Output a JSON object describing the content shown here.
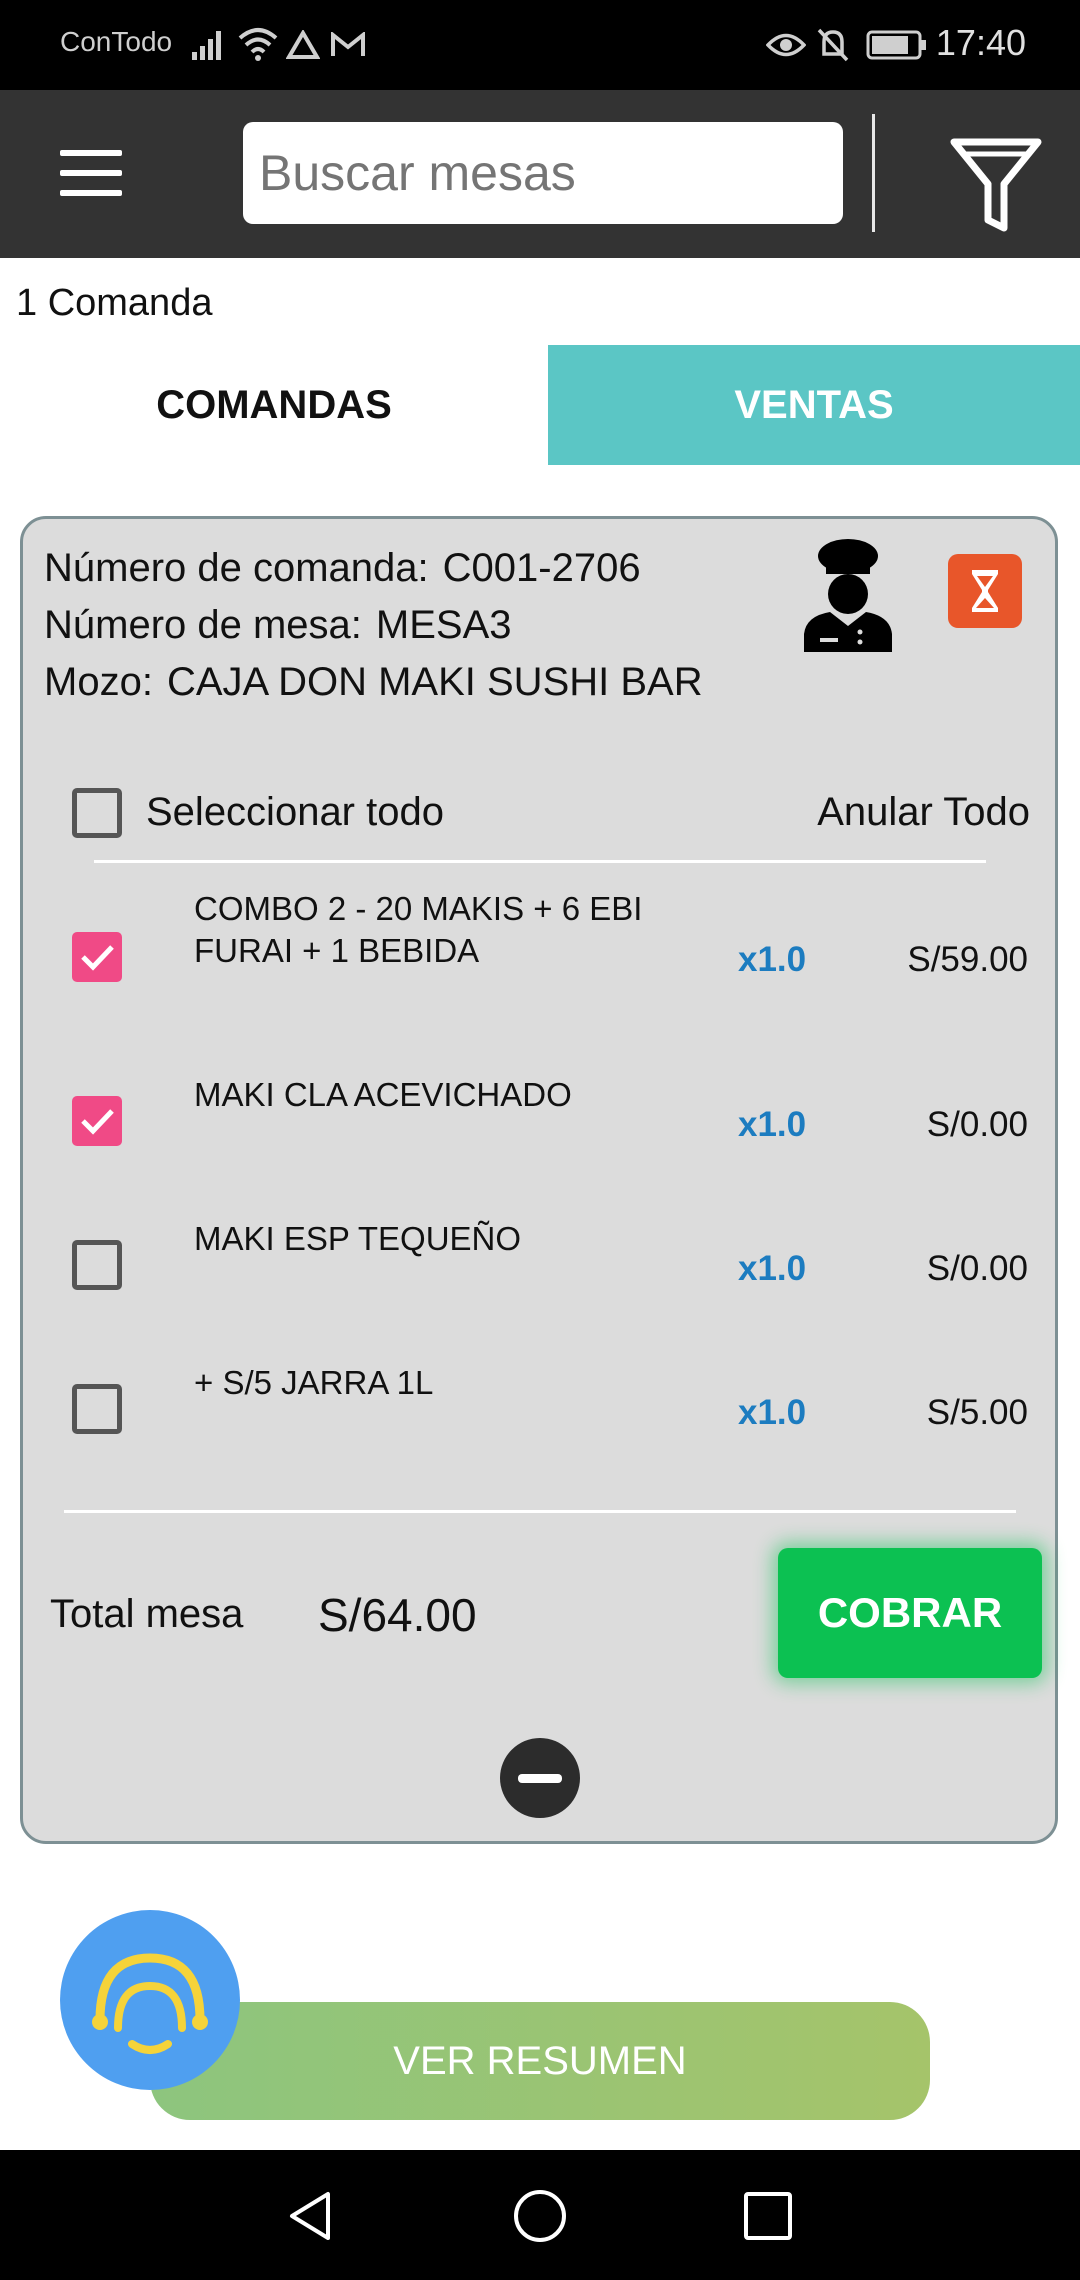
{
  "status_bar": {
    "carrier": "ConTodo",
    "time": "17:40"
  },
  "app_bar": {
    "search_placeholder": "Buscar mesas",
    "menu_icon": "hamburger-menu-icon",
    "filter_icon": "filter-funnel-icon"
  },
  "count_text": "1 Comanda",
  "tabs": [
    {
      "label": "COMANDAS",
      "active": true
    },
    {
      "label": "VENTAS",
      "active": false
    }
  ],
  "order": {
    "comanda_label": "Número de comanda:",
    "comanda_value": "C001-2706",
    "mesa_label": "Número de mesa:",
    "mesa_value": "MESA3",
    "mozo_label": "Mozo:",
    "mozo_value": "CAJA DON MAKI SUSHI BAR",
    "select_all_label": "Seleccionar todo",
    "select_all_checked": false,
    "void_all_label": "Anular Todo",
    "items": [
      {
        "name": "COMBO 2 - 20 MAKIS + 6 EBI FURAI + 1 BEBIDA",
        "qty": "x1.0",
        "price": "S/59.00",
        "checked": true
      },
      {
        "name": "MAKI CLA ACEVICHADO",
        "qty": "x1.0",
        "price": "S/0.00",
        "checked": true
      },
      {
        "name": "MAKI ESP TEQUEÑO",
        "qty": "x1.0",
        "price": "S/0.00",
        "checked": false
      },
      {
        "name": "+ S/5 JARRA 1L",
        "qty": "x1.0",
        "price": "S/5.00",
        "checked": false
      }
    ],
    "total_label": "Total mesa",
    "total_value": "S/64.00",
    "charge_label": "COBRAR"
  },
  "summary_button": "VER RESUMEN",
  "colors": {
    "appbar": "#333333",
    "tab_active_bg": "#ffffff",
    "tab_inactive_bg": "#5bc6c5",
    "checkbox_checked": "#f04a86",
    "qty_text": "#1c7cc0",
    "charge_button": "#0cc152",
    "timer_button": "#e8562a",
    "fab": "#4f9ff0"
  }
}
